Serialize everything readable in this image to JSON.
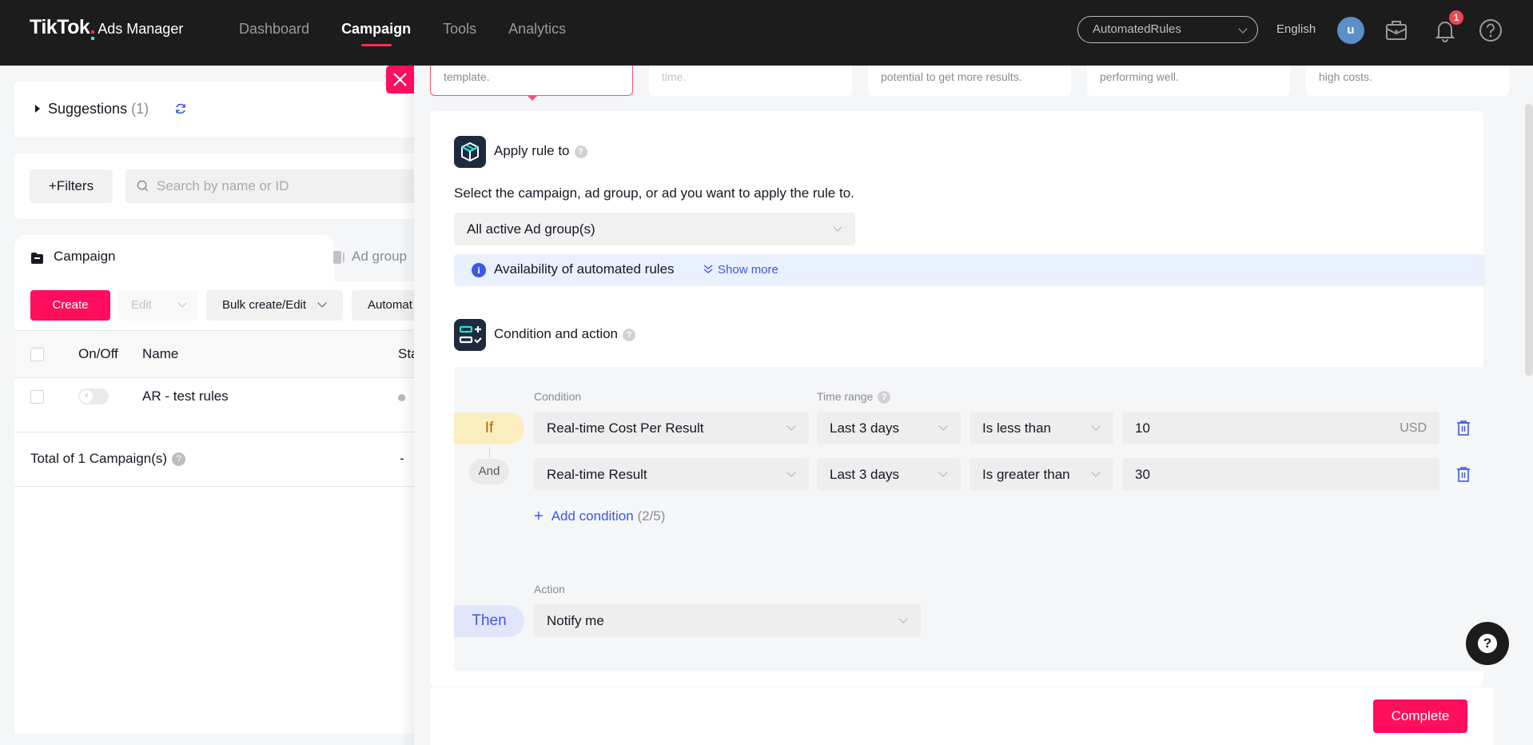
{
  "header": {
    "brand": "TikTok",
    "product": "Ads Manager",
    "nav": [
      {
        "label": "Dashboard",
        "active": false
      },
      {
        "label": "Campaign",
        "active": true
      },
      {
        "label": "Tools",
        "active": false
      },
      {
        "label": "Analytics",
        "active": false
      }
    ],
    "account_selector": "AutomatedRules",
    "language": "English",
    "avatar_initial": "u",
    "notification_count": "1",
    "accent": "#fe2c55"
  },
  "left_panel": {
    "suggestions": {
      "label": "Suggestions",
      "count": "(1)"
    },
    "filters_label": "+Filters",
    "search_placeholder": "Search by name or ID",
    "tabs": [
      {
        "label": "Campaign",
        "active": true
      },
      {
        "label": "Ad group",
        "active": false
      }
    ],
    "toolbar": {
      "create": "Create",
      "edit": "Edit",
      "bulk": "Bulk create/Edit",
      "automate": "Automat"
    },
    "table": {
      "columns": [
        "On/Off",
        "Name",
        "Sta"
      ],
      "rows": [
        {
          "name": "AR - test rules",
          "enabled": false
        }
      ],
      "total_label": "Total of 1 Campaign(s)",
      "total_status": "-"
    }
  },
  "drawer": {
    "template_cards": [
      {
        "text": "template.",
        "selected": true
      },
      {
        "text": "time.",
        "selected": false
      },
      {
        "text": "potential to get more results.",
        "selected": false
      },
      {
        "text": "performing well.",
        "selected": false
      },
      {
        "text": "high costs.",
        "selected": false
      }
    ],
    "apply_rule": {
      "title": "Apply rule to",
      "description": "Select the campaign, ad group, or ad you want to apply the rule to.",
      "selected": "All active Ad group(s)",
      "info_title": "Availability of automated rules",
      "show_more": "Show more"
    },
    "condition_action": {
      "title": "Condition and action",
      "condition_label": "Condition",
      "time_range_label": "Time range",
      "if_label": "If",
      "and_label": "And",
      "conditions": [
        {
          "metric": "Real-time Cost Per Result",
          "time_range": "Last 3 days",
          "operator": "Is less than",
          "value": "10",
          "unit": "USD"
        },
        {
          "metric": "Real-time Result",
          "time_range": "Last 3 days",
          "operator": "Is greater than",
          "value": "30",
          "unit": ""
        }
      ],
      "add_condition": "Add condition",
      "condition_count": "(2/5)",
      "action_label": "Action",
      "then_label": "Then",
      "action": "Notify me"
    },
    "complete_label": "Complete"
  }
}
